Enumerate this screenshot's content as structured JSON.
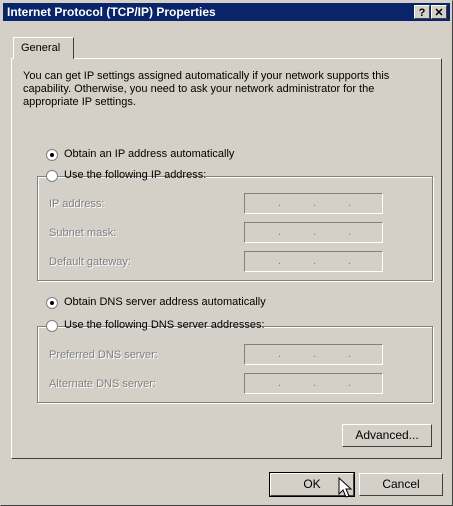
{
  "window": {
    "title": "Internet Protocol (TCP/IP) Properties",
    "help_button": "?",
    "close_button": "✕"
  },
  "tab": {
    "label": "General"
  },
  "description": "You can get IP settings assigned automatically if your network supports this capability. Otherwise, you need to ask your network administrator for the appropriate IP settings.",
  "ip_section": {
    "auto_option": {
      "label": "Obtain an IP address automatically",
      "selected": true
    },
    "manual_option": {
      "label": "Use the following IP address:",
      "selected": false
    },
    "fields": [
      {
        "label": "IP address:",
        "value": ". . ."
      },
      {
        "label": "Subnet mask:",
        "value": ". . ."
      },
      {
        "label": "Default gateway:",
        "value": ". . ."
      }
    ]
  },
  "dns_section": {
    "auto_option": {
      "label": "Obtain DNS server address automatically",
      "selected": true
    },
    "manual_option": {
      "label": "Use the following DNS server addresses:",
      "selected": false
    },
    "fields": [
      {
        "label": "Preferred DNS server:",
        "value": ". . ."
      },
      {
        "label": "Alternate DNS server:",
        "value": ". . ."
      }
    ]
  },
  "buttons": {
    "advanced": "Advanced...",
    "ok": "OK",
    "cancel": "Cancel"
  },
  "colors": {
    "titlebar": "#0a246a",
    "face": "#d4d0c8",
    "disabled_text": "#808080"
  }
}
